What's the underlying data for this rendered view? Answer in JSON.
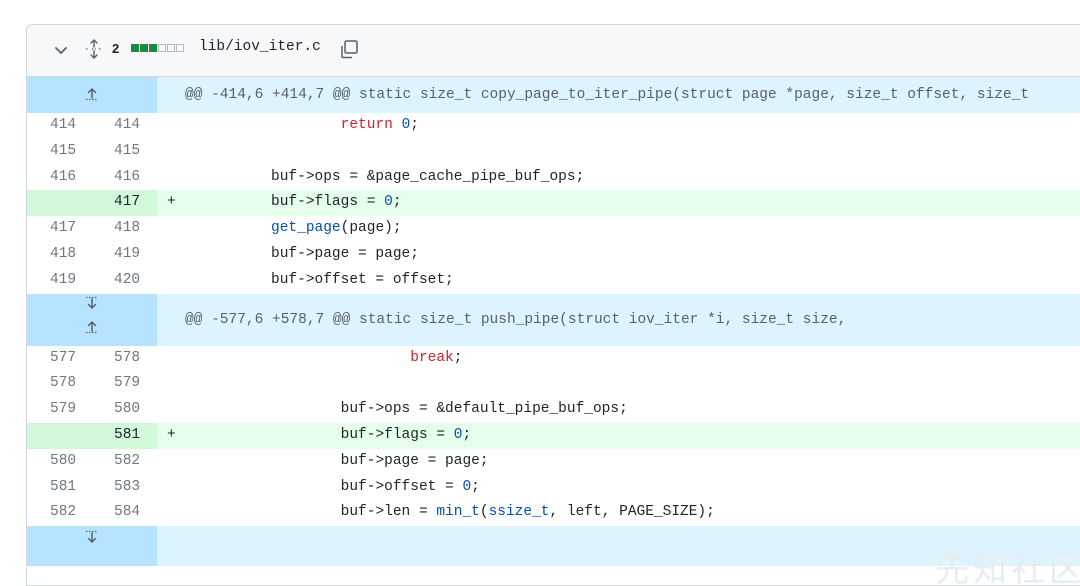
{
  "file": {
    "change_count": "2",
    "diffstat": [
      "add",
      "add",
      "add",
      "neutral",
      "neutral",
      "neutral"
    ],
    "path": "lib/iov_iter.c"
  },
  "hunks": [
    {
      "header": "@@ -414,6 +414,7 @@ static size_t copy_page_to_iter_pipe(struct page *page, size_t offset, size_t",
      "lines": [
        {
          "old": "414",
          "new": "414",
          "sign": "",
          "type": "context",
          "indent": "                  ",
          "tokens": [
            {
              "t": "return",
              "c": "kw"
            },
            {
              "t": " "
            },
            {
              "t": "0",
              "c": "nm"
            },
            {
              "t": ";"
            }
          ]
        },
        {
          "old": "415",
          "new": "415",
          "sign": "",
          "type": "context",
          "indent": "",
          "tokens": []
        },
        {
          "old": "416",
          "new": "416",
          "sign": "",
          "type": "context",
          "indent": "          ",
          "tokens": [
            {
              "t": "buf->ops = &page_cache_pipe_buf_ops;"
            }
          ]
        },
        {
          "old": "",
          "new": "417",
          "sign": "+",
          "type": "added",
          "indent": "          ",
          "tokens": [
            {
              "t": "buf->flags = "
            },
            {
              "t": "0",
              "c": "nm"
            },
            {
              "t": ";"
            }
          ]
        },
        {
          "old": "417",
          "new": "418",
          "sign": "",
          "type": "context",
          "indent": "          ",
          "tokens": [
            {
              "t": "get_page",
              "c": "fn"
            },
            {
              "t": "(page);"
            }
          ]
        },
        {
          "old": "418",
          "new": "419",
          "sign": "",
          "type": "context",
          "indent": "          ",
          "tokens": [
            {
              "t": "buf->page = page;"
            }
          ]
        },
        {
          "old": "419",
          "new": "420",
          "sign": "",
          "type": "context",
          "indent": "          ",
          "tokens": [
            {
              "t": "buf->offset = offset;"
            }
          ]
        }
      ]
    },
    {
      "header": "@@ -577,6 +578,7 @@ static size_t push_pipe(struct iov_iter *i, size_t size,",
      "lines": [
        {
          "old": "577",
          "new": "578",
          "sign": "",
          "type": "context",
          "indent": "                          ",
          "tokens": [
            {
              "t": "break",
              "c": "kw"
            },
            {
              "t": ";"
            }
          ]
        },
        {
          "old": "578",
          "new": "579",
          "sign": "",
          "type": "context",
          "indent": "",
          "tokens": []
        },
        {
          "old": "579",
          "new": "580",
          "sign": "",
          "type": "context",
          "indent": "                  ",
          "tokens": [
            {
              "t": "buf->ops = &default_pipe_buf_ops;"
            }
          ]
        },
        {
          "old": "",
          "new": "581",
          "sign": "+",
          "type": "added",
          "indent": "                  ",
          "tokens": [
            {
              "t": "buf->flags = "
            },
            {
              "t": "0",
              "c": "nm"
            },
            {
              "t": ";"
            }
          ]
        },
        {
          "old": "580",
          "new": "582",
          "sign": "",
          "type": "context",
          "indent": "                  ",
          "tokens": [
            {
              "t": "buf->page = page;"
            }
          ]
        },
        {
          "old": "581",
          "new": "583",
          "sign": "",
          "type": "context",
          "indent": "                  ",
          "tokens": [
            {
              "t": "buf->offset = "
            },
            {
              "t": "0",
              "c": "nm"
            },
            {
              "t": ";"
            }
          ]
        },
        {
          "old": "582",
          "new": "584",
          "sign": "",
          "type": "context",
          "indent": "                  ",
          "tokens": [
            {
              "t": "buf->len = "
            },
            {
              "t": "min_t",
              "c": "fn"
            },
            {
              "t": "("
            },
            {
              "t": "ssize_t",
              "c": "fn"
            },
            {
              "t": ", left, PAGE_SIZE);"
            }
          ]
        }
      ]
    }
  ],
  "icons": {
    "collapse": "chevron-down-icon",
    "expand_all": "unfold-icon",
    "copy": "copy-icon",
    "expand_up": "fold-up-icon",
    "expand_down": "fold-down-icon"
  },
  "colors": {
    "hunk_bg": "#ddf4ff",
    "hunk_gutter": "#b6e3ff",
    "added_bg": "#e6ffec",
    "added_num_bg": "#d1f8d9",
    "keyword": "#cf222e",
    "number": "#0550ae"
  },
  "watermark": "先知社区"
}
